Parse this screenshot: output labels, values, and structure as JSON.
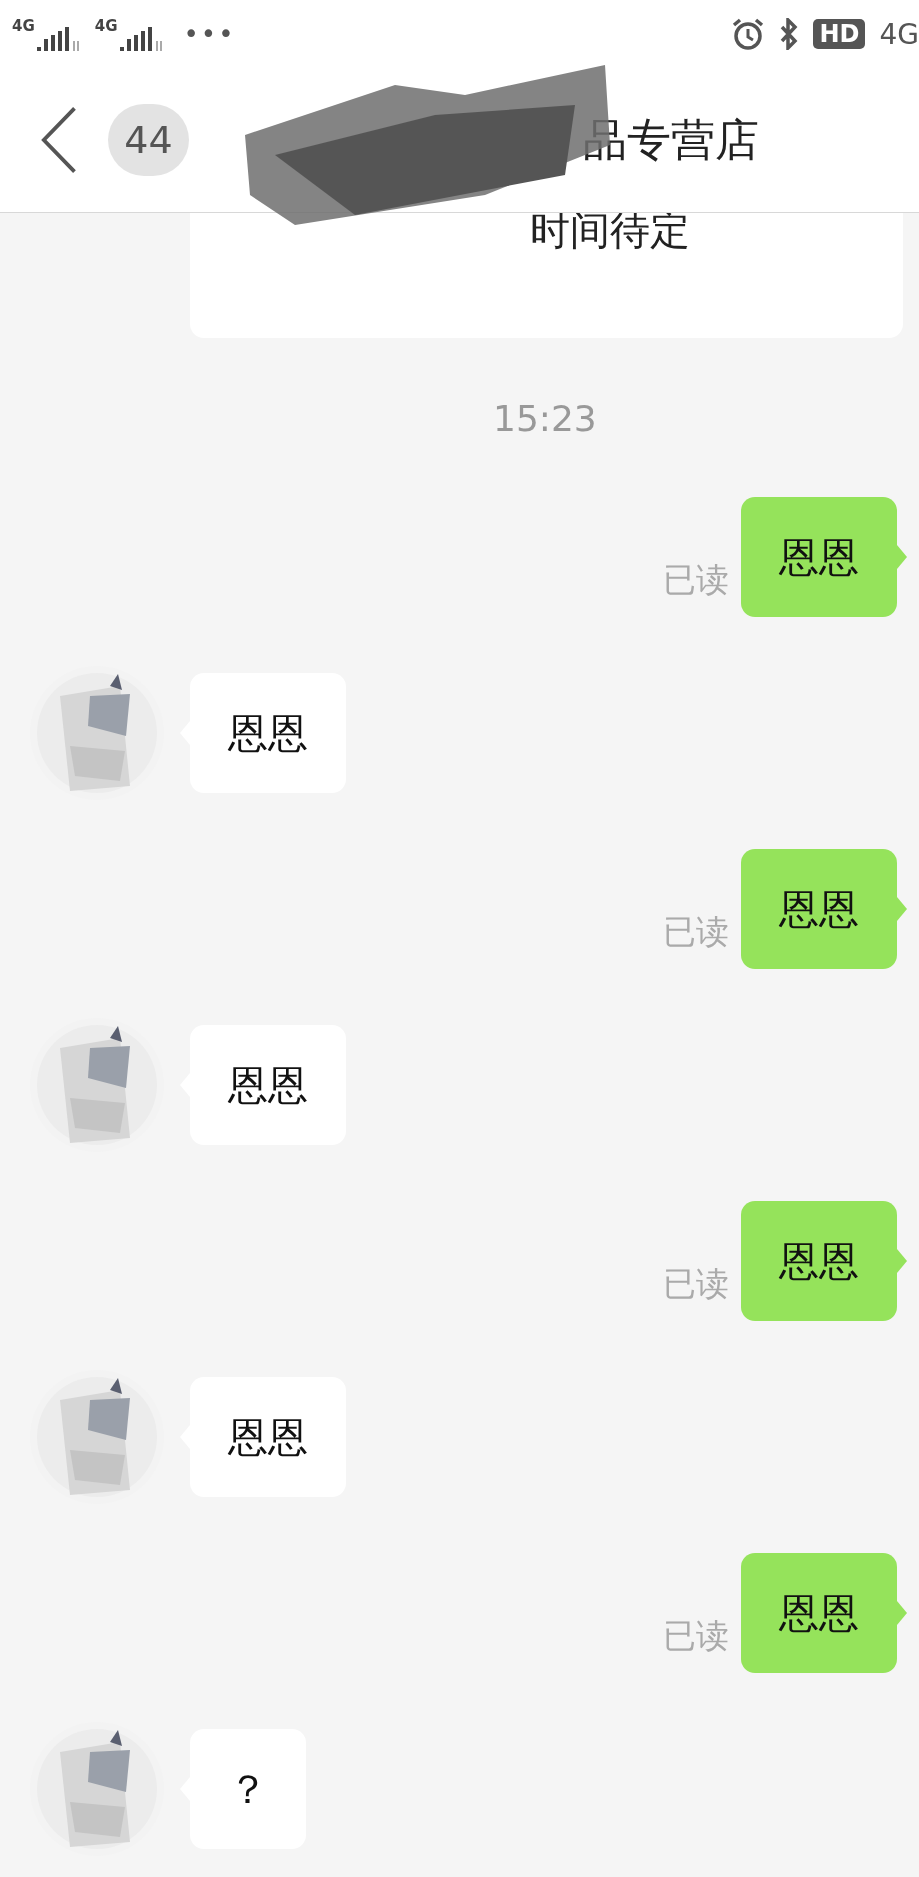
{
  "status_bar": {
    "sim_1": "4G",
    "sim_2": "4G",
    "more": "•••",
    "hd_badge": "HD",
    "network": "4G"
  },
  "header": {
    "unread_count": "44",
    "title": "品专营店"
  },
  "messages": [
    {
      "kind": "incoming-fragment",
      "text": "时间待定"
    },
    {
      "kind": "time",
      "text": "15:23"
    },
    {
      "kind": "outgoing",
      "text": "恩恩",
      "read_label": "已读"
    },
    {
      "kind": "incoming",
      "text": "恩恩"
    },
    {
      "kind": "outgoing",
      "text": "恩恩",
      "read_label": "已读"
    },
    {
      "kind": "incoming",
      "text": "恩恩"
    },
    {
      "kind": "outgoing",
      "text": "恩恩",
      "read_label": "已读"
    },
    {
      "kind": "incoming",
      "text": "恩恩"
    },
    {
      "kind": "outgoing",
      "text": "恩恩",
      "read_label": "已读"
    },
    {
      "kind": "incoming",
      "text": "？"
    }
  ]
}
